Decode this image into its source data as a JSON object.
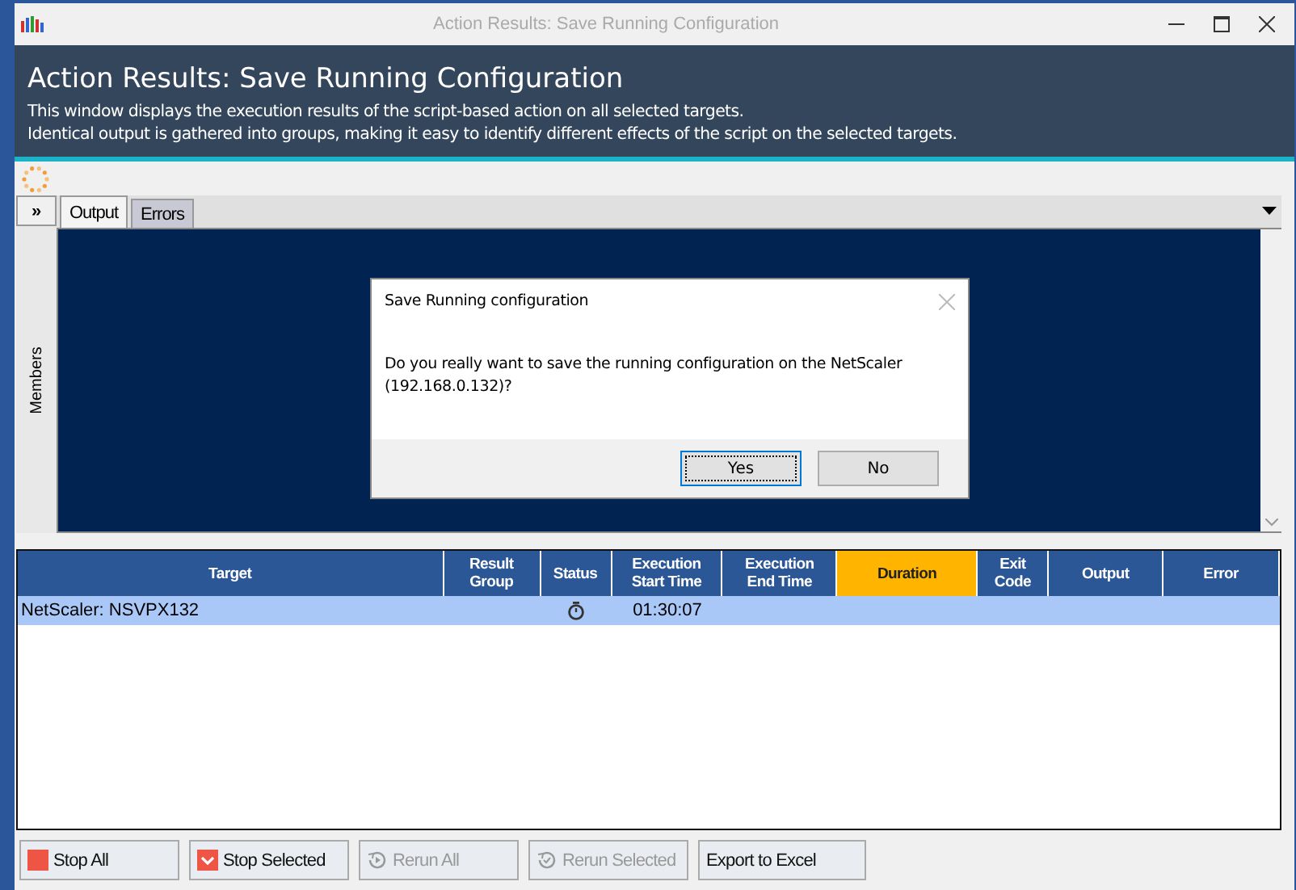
{
  "window": {
    "title": "Action Results: Save Running Configuration"
  },
  "header": {
    "title": "Action Results: Save Running Configuration",
    "lines": [
      "This window displays the execution results of the script-based action on all selected targets.",
      "Identical output is gathered into groups, making it easy to identify different effects of the script on the selected targets."
    ]
  },
  "expand_button": "»",
  "side_panel": {
    "label": "Members"
  },
  "tabs": [
    {
      "label": "Output",
      "selected": true
    },
    {
      "label": "Errors",
      "selected": false
    }
  ],
  "dialog": {
    "title": "Save Running configuration",
    "message": "Do you really want to save the running  configuration on the NetScaler (192.168.0.132)?",
    "buttons": [
      {
        "label": "Yes",
        "focused": true
      },
      {
        "label": "No",
        "focused": false
      }
    ]
  },
  "table": {
    "columns": [
      {
        "label": "Target",
        "selected": false
      },
      {
        "label": "Result Group",
        "selected": false
      },
      {
        "label": "Status",
        "selected": false
      },
      {
        "label": "Execution Start Time",
        "selected": false
      },
      {
        "label": "Execution End Time",
        "selected": false
      },
      {
        "label": "Duration",
        "selected": true
      },
      {
        "label": "Exit Code",
        "selected": false
      },
      {
        "label": "Output",
        "selected": false
      },
      {
        "label": "Error",
        "selected": false
      }
    ],
    "rows": [
      {
        "selected": true,
        "kind": "running",
        "cells": [
          "NetScaler: NSVPX132",
          "",
          "",
          "01:30:07",
          "",
          "",
          "",
          "",
          ""
        ]
      }
    ]
  },
  "buttons": [
    {
      "label": "Stop All",
      "kind": "stop",
      "disabled": false
    },
    {
      "label": "Stop Selected",
      "kind": "stopselected",
      "disabled": false
    },
    {
      "label": "Rerun All",
      "kind": "rerun",
      "disabled": true
    },
    {
      "label": "Rerun Selected",
      "kind": "rerunselected",
      "disabled": true
    },
    {
      "label": "Export to Excel",
      "kind": "plain",
      "disabled": false
    }
  ]
}
